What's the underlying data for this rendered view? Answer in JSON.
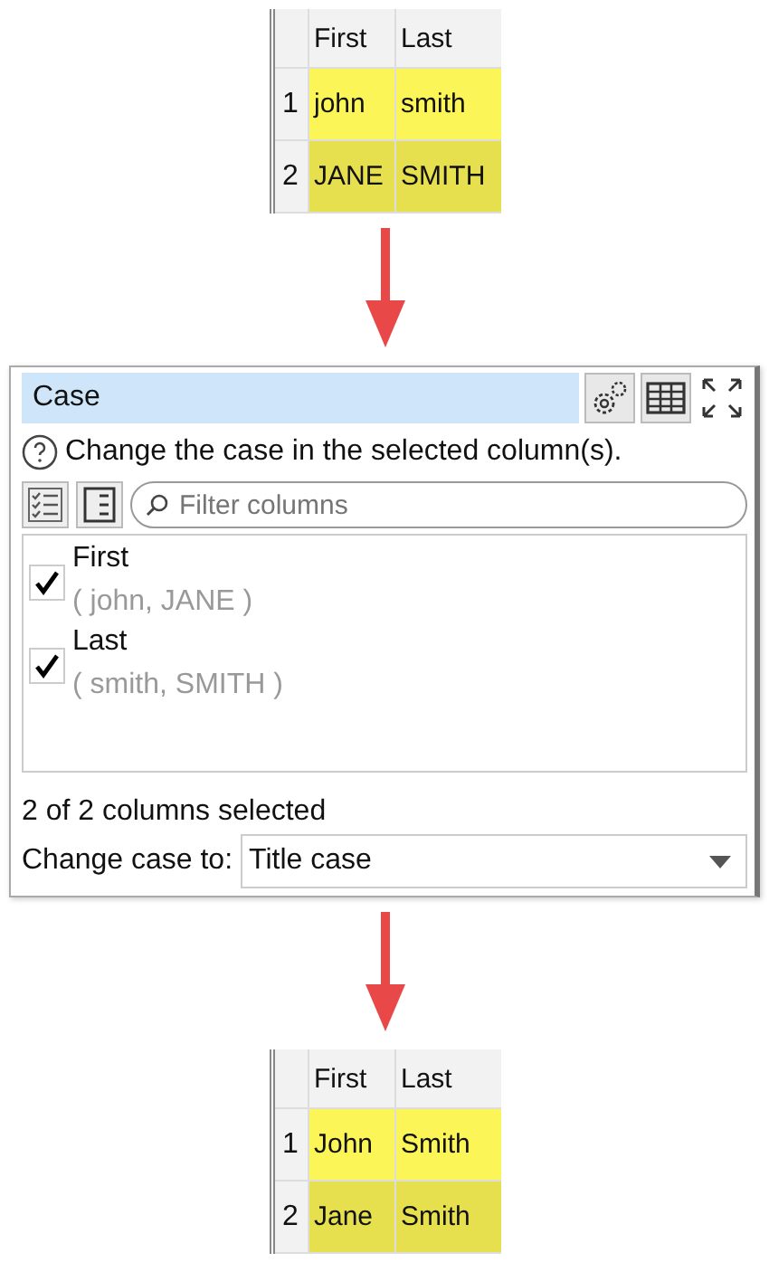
{
  "input_table": {
    "columns": [
      "First",
      "Last"
    ],
    "rows": [
      {
        "number": "1",
        "cells": [
          "john",
          "smith"
        ]
      },
      {
        "number": "2",
        "cells": [
          "JANE",
          "SMITH"
        ]
      }
    ]
  },
  "panel": {
    "title": "Case",
    "help_text": "Change the case in the selected column(s).",
    "filter": {
      "placeholder": "Filter columns"
    },
    "columns": [
      {
        "name": "First",
        "preview": "( john, JANE )",
        "checked": true
      },
      {
        "name": "Last",
        "preview": "( smith, SMITH )",
        "checked": true
      }
    ],
    "selection_summary": "2 of 2 columns selected",
    "change_case": {
      "label": "Change case to:",
      "value": "Title case"
    }
  },
  "output_table": {
    "columns": [
      "First",
      "Last"
    ],
    "rows": [
      {
        "number": "1",
        "cells": [
          "John",
          "Smith"
        ]
      },
      {
        "number": "2",
        "cells": [
          "Jane",
          "Smith"
        ]
      }
    ]
  }
}
